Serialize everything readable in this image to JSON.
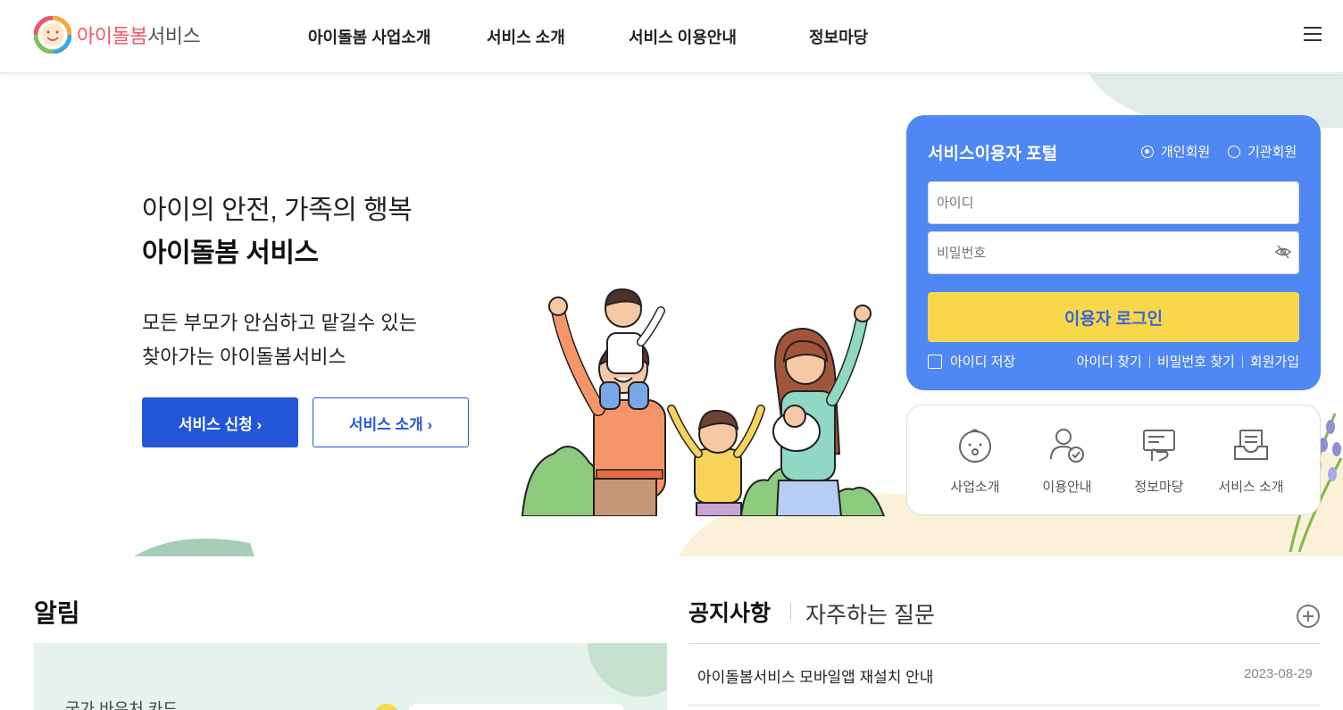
{
  "header": {
    "logo_part1": "아이돌봄",
    "logo_part2": "서비스",
    "nav": [
      "아이돌봄 사업소개",
      "서비스 소개",
      "서비스 이용안내",
      "정보마당"
    ]
  },
  "hero": {
    "subtitle": "아이의 안전, 가족의 행복",
    "title": "아이돌봄 서비스",
    "desc_line1": "모든 부모가 안심하고 맡길수 있는",
    "desc_line2": "찾아가는 아이돌봄서비스",
    "apply_button": "서비스 신청 ›",
    "intro_button": "서비스 소개 ›"
  },
  "login": {
    "title": "서비스이용자 포털",
    "radio_personal": "개인회원",
    "radio_org": "기관회원",
    "id_placeholder": "아이디",
    "pw_placeholder": "비밀번호",
    "login_button": "이용자 로그인",
    "remember_id": "아이디 저장",
    "find_id": "아이디 찾기",
    "find_pw": "비밀번호 찾기",
    "signup": "회원가입"
  },
  "quick_menu": [
    {
      "label": "사업소개",
      "icon": "baby-face-icon"
    },
    {
      "label": "이용안내",
      "icon": "user-check-icon"
    },
    {
      "label": "정보마당",
      "icon": "document-hand-icon"
    },
    {
      "label": "서비스 소개",
      "icon": "inbox-tray-icon"
    }
  ],
  "alarm": {
    "title": "알림",
    "card_text": "국가 바우처 카드"
  },
  "notice": {
    "tab_notice": "공지사항",
    "tab_faq": "자주하는 질문",
    "items": [
      {
        "title": "아이돌봄서비스 모바일앱 재설치 안내",
        "date": "2023-08-29"
      }
    ]
  },
  "colors": {
    "brand_blue": "#2356d8",
    "login_panel": "#4f87f4",
    "login_button": "#f8d84a",
    "logo_pink": "#f0566a"
  }
}
